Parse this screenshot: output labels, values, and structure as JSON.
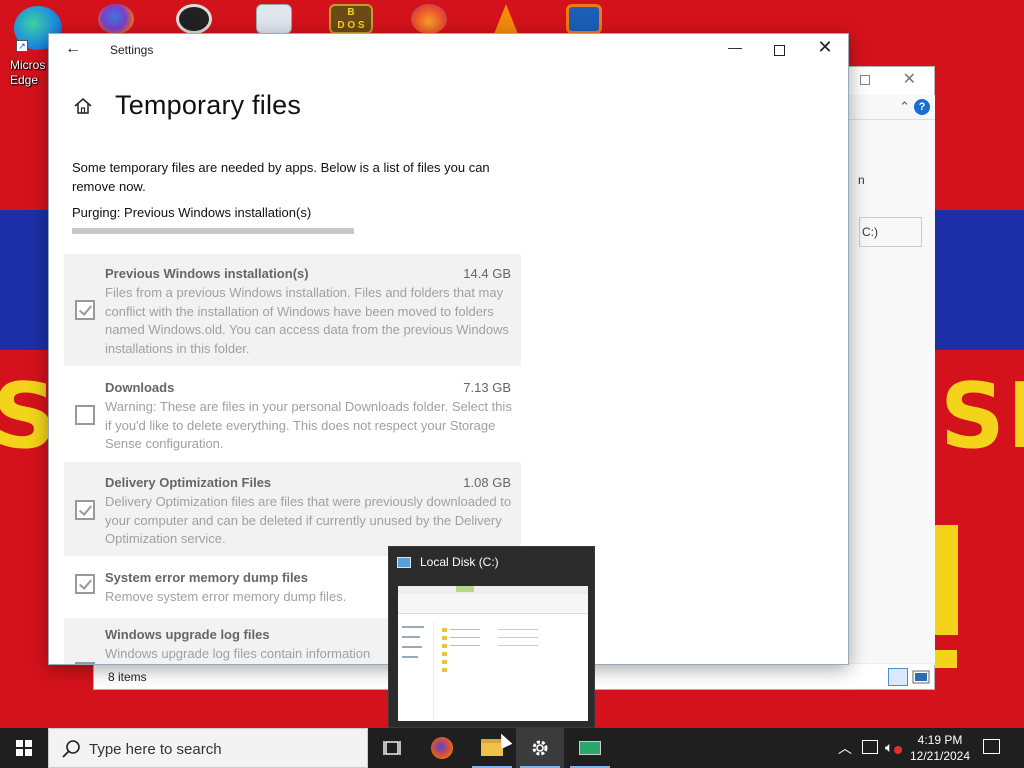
{
  "desktop": {
    "icons": [
      {
        "name": "Microsoft Edge",
        "label_line1": "Micros",
        "label_line2": "Edge"
      },
      {
        "name": "Firefox"
      },
      {
        "name": "OBS"
      },
      {
        "name": "Recycle Bin"
      },
      {
        "name": "DOSBox",
        "glyph_text": "B\nD O S"
      },
      {
        "name": "Firefox Developer"
      },
      {
        "name": "VLC"
      },
      {
        "name": "VirtualBox"
      }
    ]
  },
  "background_window": {
    "address_fragment": "C:)",
    "right_fragment": "n",
    "status": "8 items"
  },
  "settings": {
    "window_title": "Settings",
    "page_title": "Temporary files",
    "description": "Some temporary files are needed by apps. Below is a list of files you can remove now.",
    "purging_text": "Purging: Previous Windows installation(s)",
    "progress": 1.0,
    "items": [
      {
        "name": "Previous Windows installation(s)",
        "size": "14.4 GB",
        "checked": true,
        "description": "Files from a previous Windows installation.  Files and folders that may conflict with the installation of Windows have been moved to folders named Windows.old.  You can access data from the previous Windows installations in this folder."
      },
      {
        "name": "Downloads",
        "size": "7.13 GB",
        "checked": false,
        "description": "Warning: These are files in your personal Downloads folder. Select this if you'd like to delete everything. This does not respect your Storage Sense configuration."
      },
      {
        "name": "Delivery Optimization Files",
        "size": "1.08 GB",
        "checked": true,
        "description": "Delivery Optimization files are files that were previously downloaded to your computer and can be deleted if currently unused by the Delivery Optimization service."
      },
      {
        "name": "System error memory dump files",
        "size": "",
        "checked": true,
        "description": "Remove system error memory dump files."
      },
      {
        "name": "Windows upgrade log files",
        "size": "",
        "checked": false,
        "description": "Windows upgrade log files contain information"
      }
    ]
  },
  "thumbnail": {
    "title": "Local Disk (C:)"
  },
  "taskbar": {
    "search_placeholder": "Type here to search",
    "apps": [
      "Task View",
      "Firefox",
      "File Explorer",
      "Settings",
      "App"
    ],
    "clock_time": "4:19 PM",
    "clock_date": "12/21/2024"
  },
  "colors": {
    "wallpaper_red": "#d4121b",
    "wallpaper_blue": "#1c2fa6",
    "wallpaper_yellow": "#f4d41a",
    "taskbar": "#1f1f1f"
  }
}
